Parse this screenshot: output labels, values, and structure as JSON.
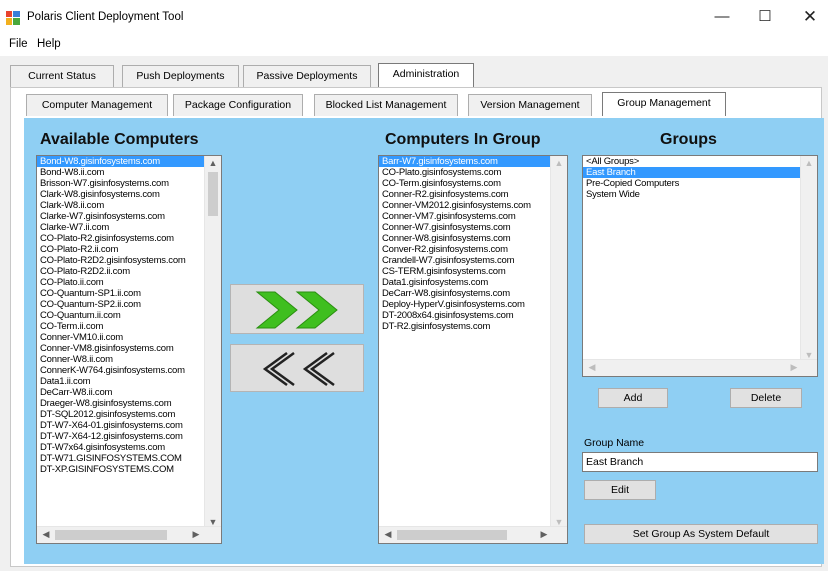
{
  "window": {
    "title": "Polaris Client Deployment Tool",
    "minimize": "—",
    "maximize": "☐",
    "close": "✕"
  },
  "menu": [
    "File",
    "Help"
  ],
  "main_tabs": [
    "Current Status",
    "Push Deployments",
    "Passive Deployments",
    "Administration"
  ],
  "sub_tabs": [
    "Computer Management",
    "Package Configuration",
    "Blocked List Management",
    "Version Management",
    "Group Management"
  ],
  "available": {
    "title": "Available Computers",
    "items": [
      "Bond-W8.gisinfosystems.com",
      "Bond-W8.ii.com",
      "Brisson-W7.gisinfosystems.com",
      "Clark-W8.gisinfosystems.com",
      "Clark-W8.ii.com",
      "Clarke-W7.gisinfosystems.com",
      "Clarke-W7.ii.com",
      "CO-Plato-R2.gisinfosystems.com",
      "CO-Plato-R2.ii.com",
      "CO-Plato-R2D2.gisinfosystems.com",
      "CO-Plato-R2D2.ii.com",
      "CO-Plato.ii.com",
      "CO-Quantum-SP1.ii.com",
      "CO-Quantum-SP2.ii.com",
      "CO-Quantum.ii.com",
      "CO-Term.ii.com",
      "Conner-VM10.ii.com",
      "Conner-VM8.gisinfosystems.com",
      "Conner-W8.ii.com",
      "ConnerK-W764.gisinfosystems.com",
      "Data1.ii.com",
      "DeCarr-W8.ii.com",
      "Draeger-W8.gisinfosystems.com",
      "DT-SQL2012.gisinfosystems.com",
      "DT-W7-X64-01.gisinfosystems.com",
      "DT-W7-X64-12.gisinfosystems.com",
      "DT-W7x64.gisinfosystems.com",
      "DT-W71.GISINFOSYSTEMS.COM",
      "DT-XP.GISINFOSYSTEMS.COM"
    ]
  },
  "in_group": {
    "title": "Computers In Group",
    "items": [
      "Barr-W7.gisinfosystems.com",
      "CO-Plato.gisinfosystems.com",
      "CO-Term.gisinfosystems.com",
      "Conner-R2.gisinfosystems.com",
      "Conner-VM2012.gisinfosystems.com",
      "Conner-VM7.gisinfosystems.com",
      "Conner-W7.gisinfosystems.com",
      "Conner-W8.gisinfosystems.com",
      "Conver-R2.gisinfosystems.com",
      "Crandell-W7.gisinfosystems.com",
      "CS-TERM.gisinfosystems.com",
      "Data1.gisinfosystems.com",
      "DeCarr-W8.gisinfosystems.com",
      "Deploy-HyperV.gisinfosystems.com",
      "DT-2008x64.gisinfosystems.com",
      "DT-R2.gisinfosystems.com"
    ]
  },
  "groups": {
    "title": "Groups",
    "items": [
      "<All Groups>",
      "East Branch",
      "Pre-Copied Computers",
      "System Wide"
    ]
  },
  "buttons": {
    "add": "Add",
    "delete": "Delete",
    "edit": "Edit",
    "set_default": "Set Group As System Default",
    "move_right_icon": "double-chevron-right-icon",
    "move_left_icon": "double-chevron-left-icon"
  },
  "group_name": {
    "label": "Group Name",
    "value": "East Branch"
  },
  "colors": {
    "panel_bg": "#8fcff3",
    "selection": "#3399ff",
    "chevron_green": "#3fbf1f",
    "chevron_dark": "#222222"
  }
}
